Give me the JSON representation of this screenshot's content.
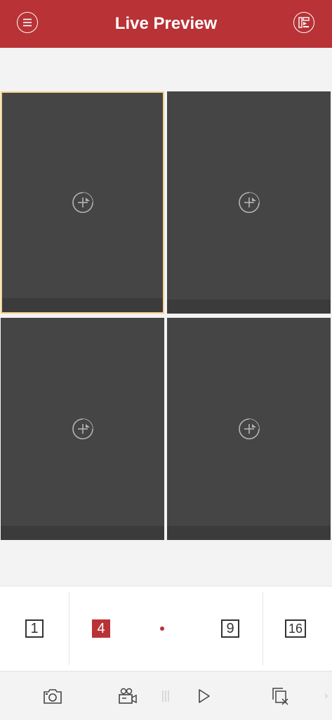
{
  "header": {
    "title": "Live Preview",
    "menu_icon": "menu-icon",
    "device_list_icon": "device-list-icon",
    "bg_color": "#b83236"
  },
  "grid": {
    "windows": [
      {
        "selected": true,
        "icon": "add-camera-icon"
      },
      {
        "selected": false,
        "icon": "add-camera-icon"
      },
      {
        "selected": false,
        "icon": "add-camera-icon"
      },
      {
        "selected": false,
        "icon": "add-camera-icon"
      }
    ],
    "selected_border_color": "#f4d08a"
  },
  "window_selector": {
    "options": [
      "1",
      "4",
      "9",
      "16"
    ],
    "active": "4",
    "accent_color": "#b83236"
  },
  "toolbar": {
    "tools": [
      "camera-icon",
      "record-video-icon",
      "play-icon",
      "close-all-icon"
    ]
  }
}
